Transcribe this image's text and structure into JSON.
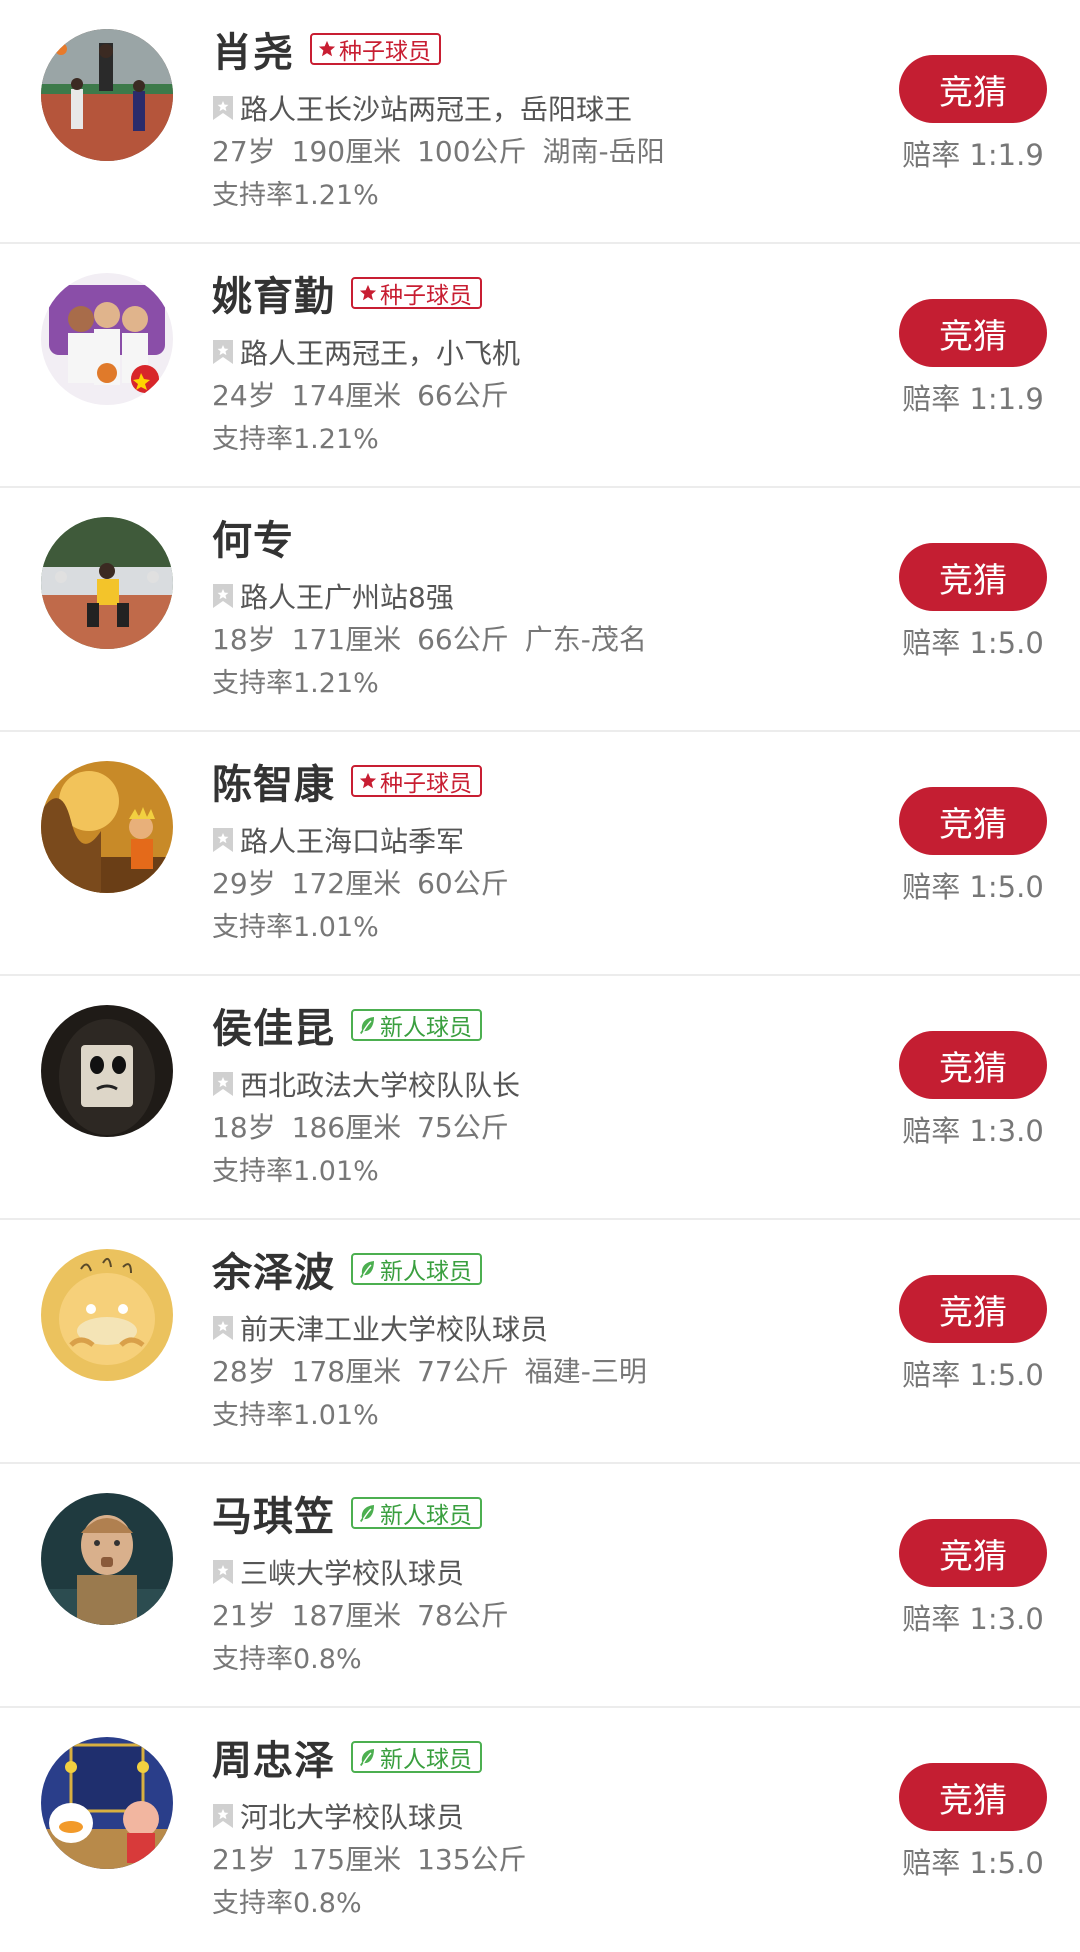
{
  "colors": {
    "accent": "#c41e32",
    "seed_badge": "#c81e32",
    "new_badge": "#4caf50"
  },
  "players": [
    {
      "name": "肖尧",
      "badge": {
        "type": "seed",
        "icon": "star-icon",
        "label": "种子球员"
      },
      "desc": "路人王长沙站两冠王，岳阳球王",
      "stats": [
        "27岁",
        "190厘米",
        "100公斤",
        "湖南-岳阳"
      ],
      "support": "支持率1.21%",
      "button": "竞猜",
      "odds": "赔率 1:1.9",
      "avatar_icon": "basketball-court-photo"
    },
    {
      "name": "姚育勤",
      "badge": {
        "type": "seed",
        "icon": "star-icon",
        "label": "种子球员"
      },
      "desc": "路人王两冠王，小飞机",
      "stats": [
        "24岁",
        "174厘米",
        "66公斤"
      ],
      "support": "支持率1.21%",
      "button": "竞猜",
      "odds": "赔率 1:1.9",
      "avatar_icon": "team-cartoon-photo"
    },
    {
      "name": "何专",
      "badge": null,
      "desc": "路人王广州站8强",
      "stats": [
        "18岁",
        "171厘米",
        "66公斤",
        "广东-茂名"
      ],
      "support": "支持率1.21%",
      "button": "竞猜",
      "odds": "赔率 1:5.0",
      "avatar_icon": "street-court-photo"
    },
    {
      "name": "陈智康",
      "badge": {
        "type": "seed",
        "icon": "star-icon",
        "label": "种子球员"
      },
      "desc": "路人王海口站季军",
      "stats": [
        "29岁",
        "172厘米",
        "60公斤"
      ],
      "support": "支持率1.01%",
      "button": "竞猜",
      "odds": "赔率 1:5.0",
      "avatar_icon": "anime-sunset-photo"
    },
    {
      "name": "侯佳昆",
      "badge": {
        "type": "new",
        "icon": "leaf-icon",
        "label": "新人球员"
      },
      "desc": "西北政法大学校队队长",
      "stats": [
        "18岁",
        "186厘米",
        "75公斤"
      ],
      "support": "支持率1.01%",
      "button": "竞猜",
      "odds": "赔率 1:3.0",
      "avatar_icon": "masked-face-photo"
    },
    {
      "name": "余泽波",
      "badge": {
        "type": "new",
        "icon": "leaf-icon",
        "label": "新人球员"
      },
      "desc": "前天津工业大学校队球员",
      "stats": [
        "28岁",
        "178厘米",
        "77公斤",
        "福建-三明"
      ],
      "support": "支持率1.01%",
      "button": "竞猜",
      "odds": "赔率 1:5.0",
      "avatar_icon": "yellow-duck-cartoon"
    },
    {
      "name": "马琪笠",
      "badge": {
        "type": "new",
        "icon": "leaf-icon",
        "label": "新人球员"
      },
      "desc": "三峡大学校队球员",
      "stats": [
        "21岁",
        "187厘米",
        "78公斤"
      ],
      "support": "支持率0.8%",
      "button": "竞猜",
      "odds": "赔率 1:3.0",
      "avatar_icon": "boy-portrait-photo"
    },
    {
      "name": "周忠泽",
      "badge": {
        "type": "new",
        "icon": "leaf-icon",
        "label": "新人球员"
      },
      "desc": "河北大学校队球员",
      "stats": [
        "21岁",
        "175厘米",
        "135公斤"
      ],
      "support": "支持率0.8%",
      "button": "竞猜",
      "odds": "赔率 1:5.0",
      "avatar_icon": "cartoon-duck-scene"
    }
  ]
}
